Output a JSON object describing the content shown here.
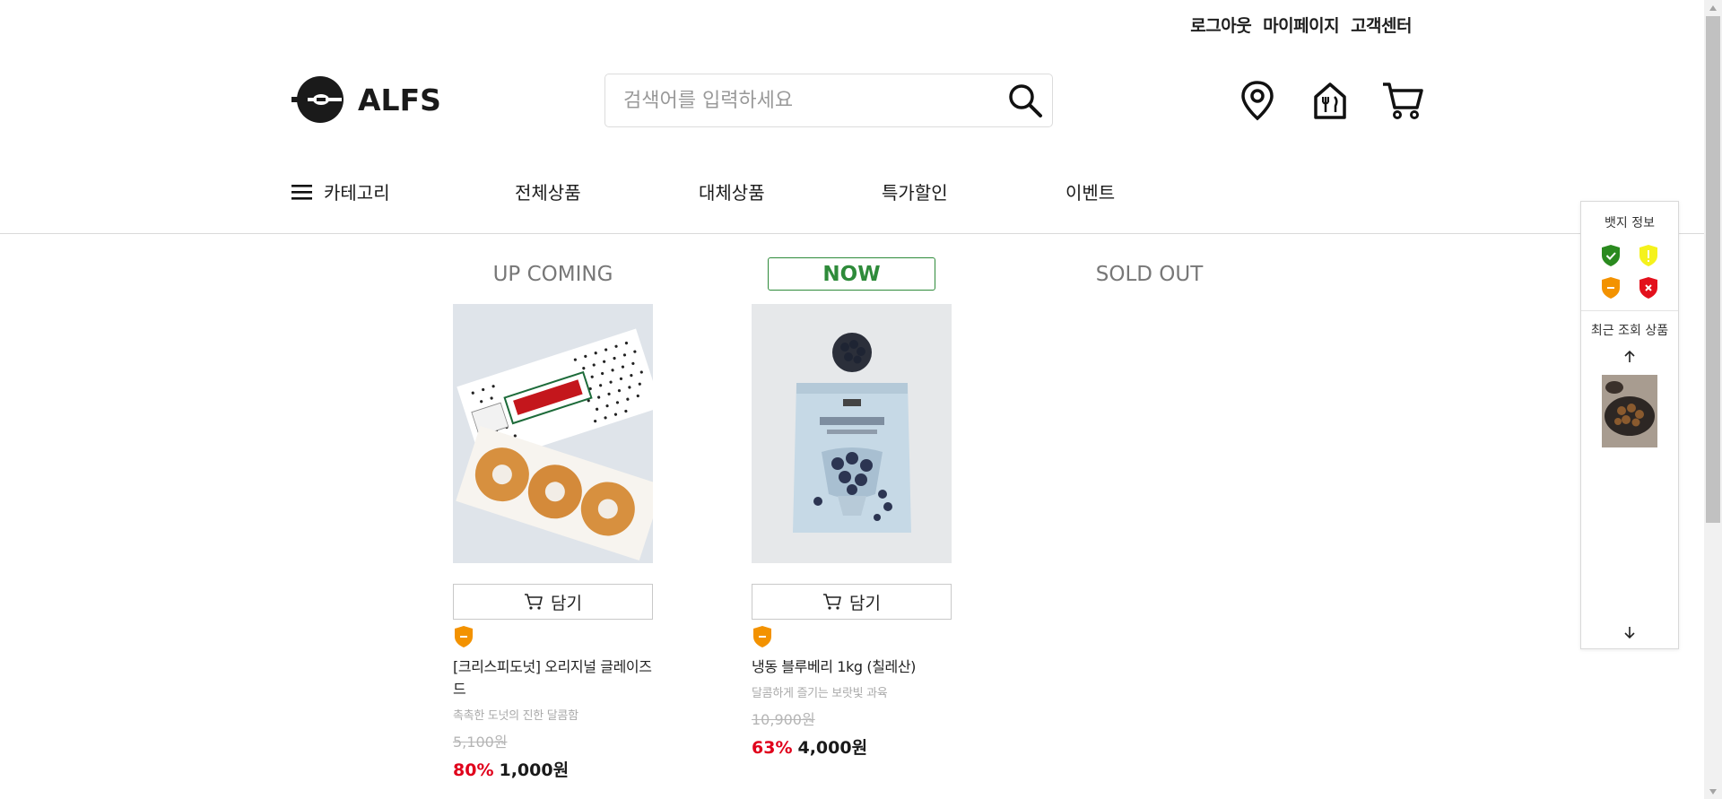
{
  "top_links": {
    "logout": "로그아웃",
    "mypage": "마이페이지",
    "support": "고객센터"
  },
  "logo": {
    "text": "ALFS"
  },
  "search": {
    "placeholder": "검색어를 입력하세요"
  },
  "nav": {
    "category": "카테고리",
    "all": "전체상품",
    "alternative": "대체상품",
    "sale": "특가할인",
    "event": "이벤트"
  },
  "tabs": {
    "upcoming": "UP COMING",
    "now": "NOW",
    "soldout": "SOLD OUT"
  },
  "products": [
    {
      "cart_label": "담기",
      "name": "[크리스피도넛] 오리지널 글레이즈드",
      "desc": "촉촉한 도넛의 진한 달콤함",
      "original_price": "5,100원",
      "discount": "80%",
      "price": "1,000원"
    },
    {
      "cart_label": "담기",
      "name": "냉동 블루베리 1kg (칠레산)",
      "desc": "달콤하게 즐기는 보랏빛 과육",
      "original_price": "10,900원",
      "discount": "63%",
      "price": "4,000원"
    }
  ],
  "side_panel": {
    "badge_title": "뱃지 정보",
    "recent_title": "최근 조회 상품"
  },
  "colors": {
    "accent_green": "#2e8b3a",
    "discount_red": "#e0001b",
    "badge_orange": "#f39200"
  }
}
